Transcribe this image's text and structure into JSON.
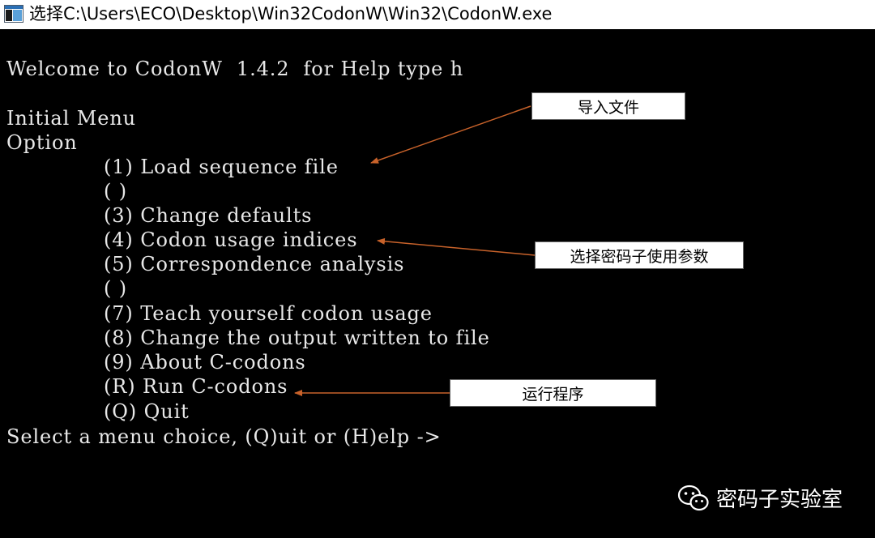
{
  "window": {
    "title": "选择C:\\Users\\ECO\\Desktop\\Win32CodonW\\Win32\\CodonW.exe"
  },
  "console": {
    "welcome": "Welcome to CodonW  1.4.2  for Help type h",
    "menu_title": "Initial Menu",
    "option_label": "Option",
    "items": [
      "(1) Load sequence file",
      "( )",
      "(3) Change defaults",
      "(4) Codon usage indices",
      "(5) Correspondence analysis",
      "( )",
      "(7) Teach yourself codon usage",
      "(8) Change the output written to file",
      "(9) About C-codons",
      "(R) Run C-codons",
      "(Q) Quit"
    ],
    "prompt": "Select a menu choice, (Q)uit or (H)elp ->"
  },
  "annotations": {
    "import_file": "导入文件",
    "select_params": "选择密码子使用参数",
    "run_program": "运行程序",
    "arrow_color": "#c8622a"
  },
  "watermark": {
    "icon": "wechat-icon",
    "text": "密码子实验室"
  }
}
